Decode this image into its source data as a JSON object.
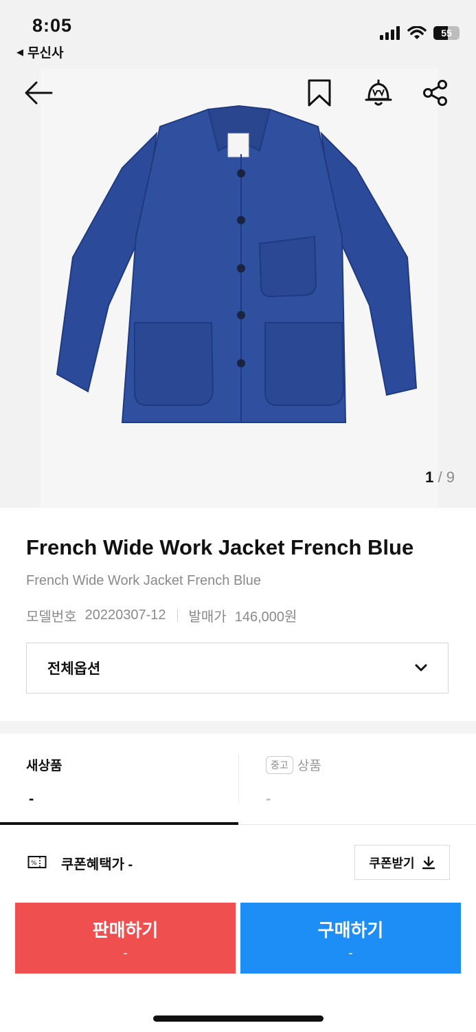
{
  "status_bar": {
    "time": "8:05",
    "back_app_label": "무신사",
    "battery": "55"
  },
  "product_image": {
    "current_page": "1",
    "separator": "/",
    "total_pages": "9"
  },
  "product": {
    "title": "French Wide Work Jacket French Blue",
    "subtitle": "French Wide Work Jacket French Blue",
    "model_label": "모델번호",
    "model_value": "20220307-12",
    "release_price_label": "발매가",
    "release_price_value": "146,000원"
  },
  "option_select": {
    "label": "전체옵션"
  },
  "tabs": {
    "new_label": "새상품",
    "new_value": "-",
    "used_badge": "중고",
    "used_label": "상품",
    "used_value": "-"
  },
  "coupon": {
    "label": "쿠폰혜택가 -",
    "button_label": "쿠폰받기"
  },
  "actions": {
    "sell_label": "판매하기",
    "sell_value": "-",
    "buy_label": "구매하기",
    "buy_value": "-"
  },
  "colors": {
    "sell": "#ef4f4f",
    "buy": "#1e8ef7",
    "jacket": "#2c4a9a"
  }
}
